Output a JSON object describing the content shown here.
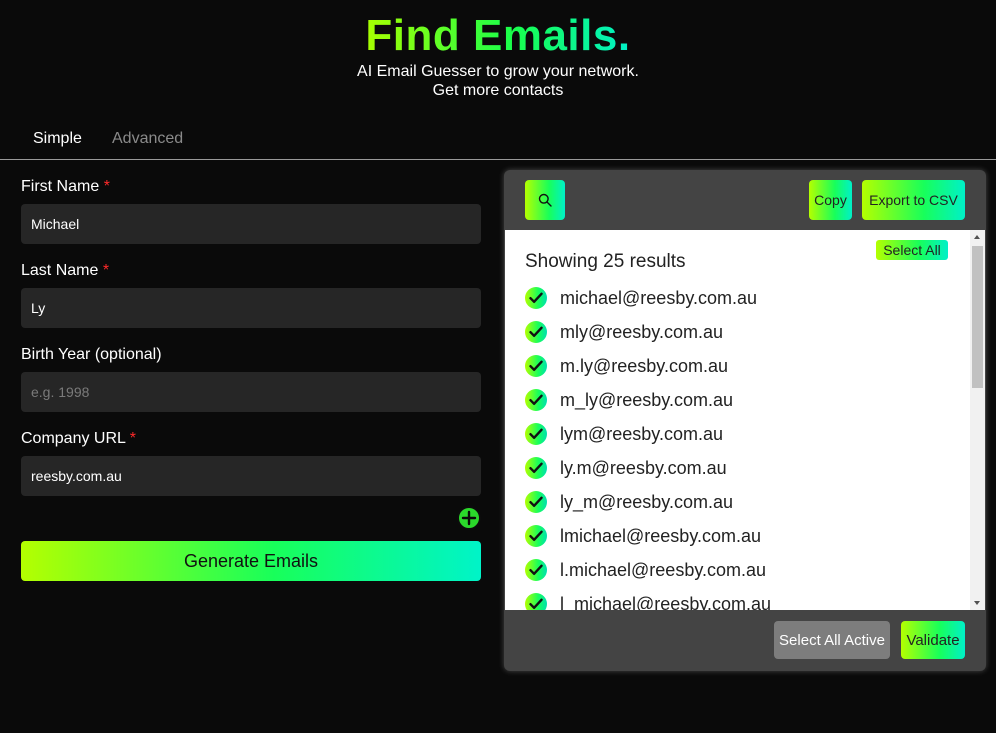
{
  "header": {
    "title": "Find Emails.",
    "subtitle_line1": "AI Email Guesser to grow your network.",
    "subtitle_line2": "Get more contacts"
  },
  "tabs": [
    {
      "label": "Simple",
      "active": true
    },
    {
      "label": "Advanced",
      "active": false
    }
  ],
  "form": {
    "first_name": {
      "label": "First Name",
      "required_mark": "*",
      "value": "Michael"
    },
    "last_name": {
      "label": "Last Name",
      "required_mark": "*",
      "value": "Ly"
    },
    "birth_year": {
      "label": "Birth Year (optional)",
      "placeholder": "e.g. 1998",
      "value": ""
    },
    "company_url": {
      "label": "Company URL",
      "required_mark": "*",
      "value": "reesby.com.au"
    },
    "add_icon": "plus-icon",
    "generate_label": "Generate Emails"
  },
  "results_panel": {
    "search_icon": "search-icon",
    "copy_label": "Copy",
    "export_label": "Export to CSV",
    "select_all_label": "Select All",
    "showing_text": "Showing 25 results",
    "emails": [
      "michael@reesby.com.au",
      "mly@reesby.com.au",
      "m.ly@reesby.com.au",
      "m_ly@reesby.com.au",
      "lym@reesby.com.au",
      "ly.m@reesby.com.au",
      "ly_m@reesby.com.au",
      "lmichael@reesby.com.au",
      "l.michael@reesby.com.au",
      "l_michael@reesby.com.au"
    ],
    "select_all_active_label": "Select All Active",
    "validate_label": "Validate"
  },
  "colors": {
    "background": "#0a0a0a",
    "accent_start": "#b4ff00",
    "accent_mid": "#18ff5a",
    "accent_end": "#00f0c8",
    "required": "#ff2a2a",
    "panel": "#444444"
  }
}
